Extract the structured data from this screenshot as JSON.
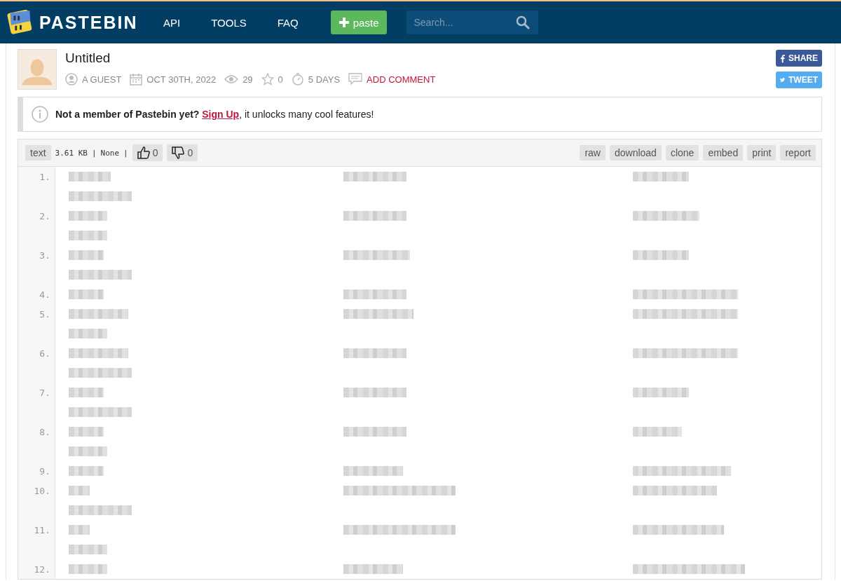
{
  "header": {
    "logo": "PASTEBIN",
    "nav": [
      "API",
      "TOOLS",
      "FAQ"
    ],
    "new_paste": "paste",
    "search": {
      "placeholder": "Search..."
    }
  },
  "paste": {
    "title": "Untitled",
    "author": "A GUEST",
    "date": "OCT 30TH, 2022",
    "views": "29",
    "stars": "0",
    "expires": "5 DAYS",
    "add_comment": "ADD COMMENT"
  },
  "share": {
    "facebook": "SHARE",
    "twitter": "TWEET"
  },
  "notice": {
    "lead": "Not a member of Pastebin yet?",
    "link": "Sign Up",
    "rest": ", it unlocks many cool features!"
  },
  "toolbar": {
    "syntax": "text",
    "size": "3.61 KB",
    "separator_1": "|",
    "category": "None",
    "separator_2": "|",
    "likes": "0",
    "dislikes": "0",
    "actions": [
      "raw",
      "download",
      "clone",
      "embed",
      "print",
      "report"
    ]
  },
  "lines": [
    {
      "number": "1.",
      "wrapped": true
    },
    {
      "number": "2.",
      "wrapped": true
    },
    {
      "number": "3.",
      "wrapped": true
    },
    {
      "number": "4.",
      "wrapped": false
    },
    {
      "number": "5.",
      "wrapped": true
    },
    {
      "number": "6.",
      "wrapped": true
    },
    {
      "number": "7.",
      "wrapped": true
    },
    {
      "number": "8.",
      "wrapped": true
    },
    {
      "number": "9.",
      "wrapped": false
    },
    {
      "number": "10.",
      "wrapped": true
    },
    {
      "number": "11.",
      "wrapped": true
    },
    {
      "number": "12.",
      "wrapped": false
    }
  ]
}
